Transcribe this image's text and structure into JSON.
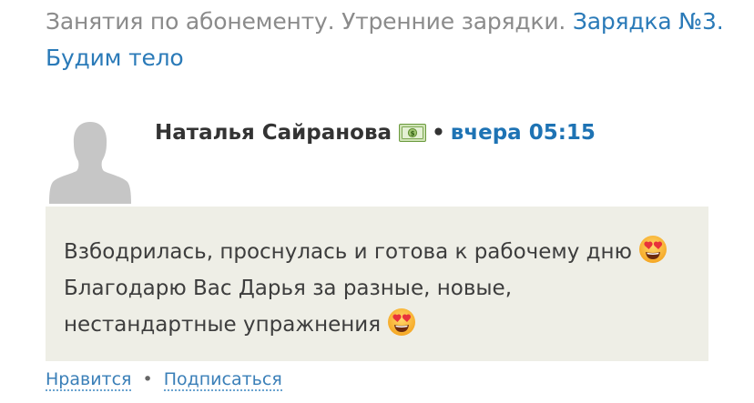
{
  "breadcrumb": {
    "lead": "Занятия по абонементу. Утренние зарядки. ",
    "link_line1": "Зарядка №3.",
    "link_line2": "Будим тело"
  },
  "comment": {
    "author": "Наталья Сайранова",
    "separator": "•",
    "time": "вчера 05:15",
    "text_part1": "Взбодрилась, проснулась и готова к рабочему дню ",
    "text_part2": " Благодарю Вас Дарья за разные, новые, нестандартные упражнения "
  },
  "actions": {
    "like_label": "Нравится",
    "separator": "•",
    "subscribe_label": "Подписаться"
  },
  "colors": {
    "link": "#2a7ab8",
    "muted_text": "#8b8b8b",
    "comment_bg": "#eeeee6"
  },
  "icons": [
    "default-avatar-icon",
    "money-icon",
    "heart-eyes-emoji-icon"
  ]
}
